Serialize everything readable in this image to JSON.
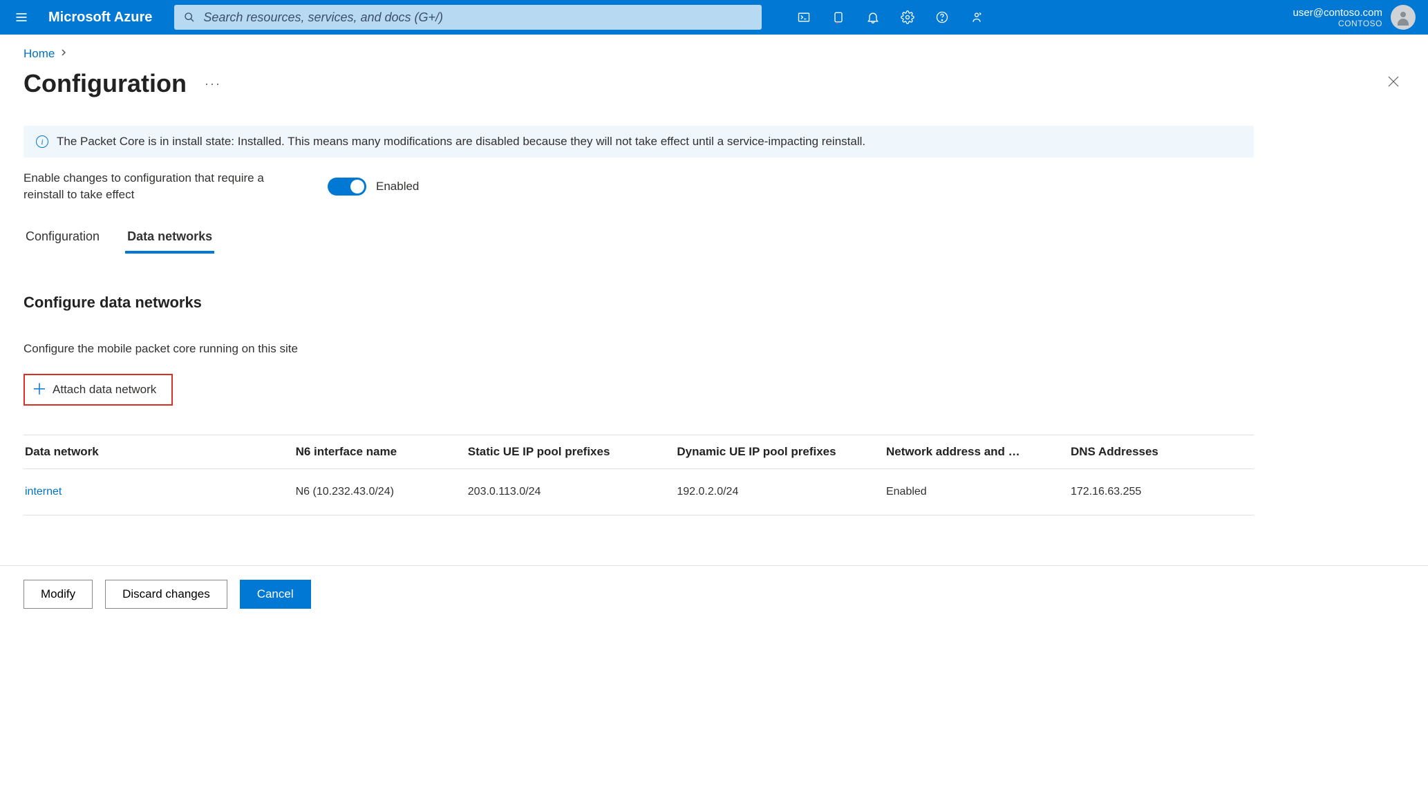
{
  "header": {
    "brand": "Microsoft Azure",
    "search_placeholder": "Search resources, services, and docs (G+/)",
    "account": {
      "email": "user@contoso.com",
      "org": "CONTOSO"
    }
  },
  "breadcrumb": {
    "home": "Home"
  },
  "page": {
    "title": "Configuration",
    "info_message": "The Packet Core is in install state: Installed. This means many modifications are disabled because they will not take effect until a service-impacting reinstall.",
    "toggle_label": "Enable changes to configuration that require a reinstall to take effect",
    "toggle_state": "Enabled"
  },
  "tabs": [
    {
      "label": "Configuration",
      "active": false
    },
    {
      "label": "Data networks",
      "active": true
    }
  ],
  "section": {
    "heading": "Configure data networks",
    "sub": "Configure the mobile packet core running on this site",
    "attach_label": "Attach data network"
  },
  "table": {
    "columns": [
      "Data network",
      "N6 interface name",
      "Static UE IP pool prefixes",
      "Dynamic UE IP pool prefixes",
      "Network address and …",
      "DNS Addresses"
    ],
    "rows": [
      {
        "name": "internet",
        "n6": "N6 (10.232.43.0/24)",
        "static": "203.0.113.0/24",
        "dynamic": "192.0.2.0/24",
        "nat": "Enabled",
        "dns": "172.16.63.255"
      }
    ]
  },
  "footer": {
    "modify": "Modify",
    "discard": "Discard changes",
    "cancel": "Cancel"
  }
}
